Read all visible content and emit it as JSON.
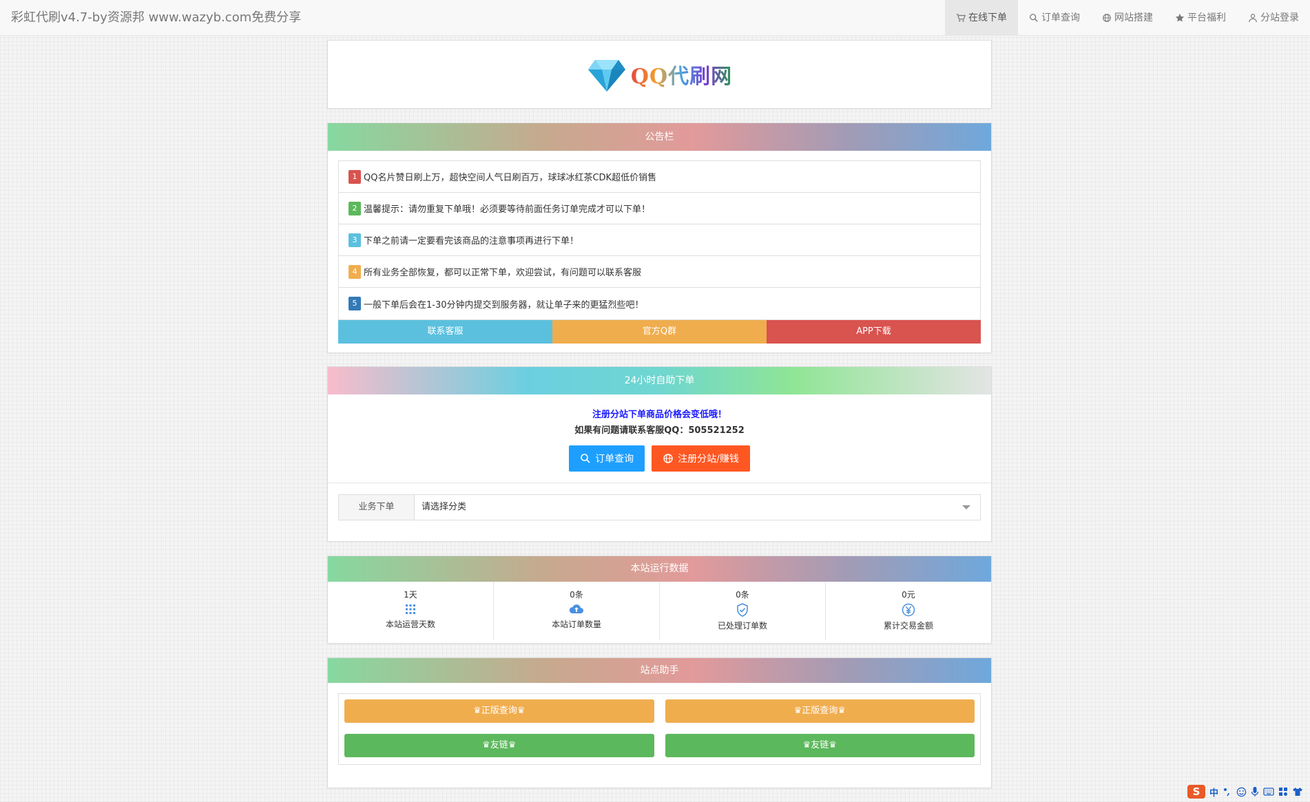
{
  "navbar": {
    "brand": "彩虹代刷v4.7-by资源邦 www.wazyb.com免费分享",
    "items": [
      {
        "label": "在线下单",
        "icon": "cart-icon"
      },
      {
        "label": "订单查询",
        "icon": "search-icon"
      },
      {
        "label": "网站搭建",
        "icon": "globe-icon"
      },
      {
        "label": "平台福利",
        "icon": "star-icon"
      },
      {
        "label": "分站登录",
        "icon": "user-icon"
      }
    ]
  },
  "logo": {
    "text": "QQ代刷网"
  },
  "notice": {
    "title": "公告栏",
    "items": [
      {
        "num": "1",
        "text": "QQ名片赞日刷上万，超快空间人气日刷百万，球球冰红茶CDK超低价销售",
        "color": "#d9534f"
      },
      {
        "num": "2",
        "text": "温馨提示：请勿重复下单哦！必须要等待前面任务订单完成才可以下单！",
        "color": "#5cb85c"
      },
      {
        "num": "3",
        "text": "下单之前请一定要看完该商品的注意事项再进行下单！",
        "color": "#5bc0de"
      },
      {
        "num": "4",
        "text": "所有业务全部恢复，都可以正常下单，欢迎尝试，有问题可以联系客服",
        "color": "#f0ad4e"
      },
      {
        "num": "5",
        "text": "一般下单后会在1-30分钟内提交到服务器，就让单子来的更猛烈些吧！",
        "color": "#337ab7"
      }
    ],
    "buttons": [
      {
        "label": "联系客服",
        "color": "#5bc0de"
      },
      {
        "label": "官方Q群",
        "color": "#f0ad4e"
      },
      {
        "label": "APP下载",
        "color": "#d9534f"
      }
    ]
  },
  "order": {
    "title": "24小时自助下单",
    "tip1": "注册分站下单商品价格会变低哦！",
    "tip2": "如果有问题请联系客服QQ：505521252",
    "query_button": "订单查询",
    "register_button": "注册分站/赚钱",
    "select_label": "业务下单",
    "select_value": "请选择分类"
  },
  "stats": {
    "title": "本站运行数据",
    "items": [
      {
        "value": "1天",
        "label": "本站运营天数",
        "icon": "grid-icon"
      },
      {
        "value": "0条",
        "label": "本站订单数量",
        "icon": "cloud-upload-icon"
      },
      {
        "value": "0条",
        "label": "已处理订单数",
        "icon": "shield-check-icon"
      },
      {
        "value": "0元",
        "label": "累计交易金额",
        "icon": "yen-icon"
      }
    ]
  },
  "helper": {
    "title": "站点助手",
    "buttons": [
      {
        "label": "♛正版查询♛",
        "color": "#f0ad4e"
      },
      {
        "label": "♛正版查询♛",
        "color": "#f0ad4e"
      },
      {
        "label": "♛友链♛",
        "color": "#5cb85c"
      },
      {
        "label": "♛友链♛",
        "color": "#5cb85c"
      }
    ]
  },
  "ime": {
    "logo": "S",
    "mode": "中"
  }
}
